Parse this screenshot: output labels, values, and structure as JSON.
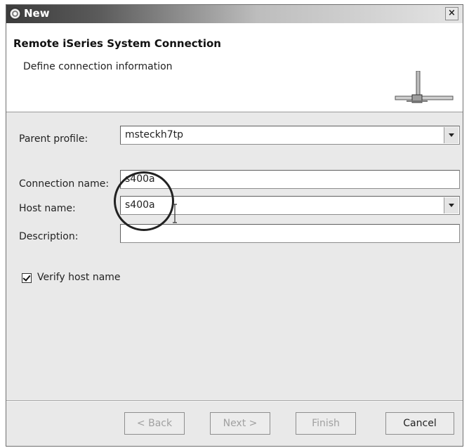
{
  "window": {
    "title": "New",
    "close_glyph": "×"
  },
  "banner": {
    "title": "Remote iSeries System Connection",
    "subtitle": "Define connection information"
  },
  "form": {
    "parent_profile": {
      "label": "Parent profile:",
      "value": "msteckh7tp"
    },
    "connection_name": {
      "label": "Connection name:",
      "value": "s400a"
    },
    "host_name": {
      "label": "Host name:",
      "value": "s400a"
    },
    "description": {
      "label": "Description:",
      "value": ""
    },
    "verify_host": {
      "label": "Verify host name",
      "checked": true
    }
  },
  "buttons": {
    "back": "< Back",
    "next": "Next >",
    "finish": "Finish",
    "cancel": "Cancel"
  },
  "icons": {
    "title": "eclipse-icon",
    "banner": "connection-wizard-icon",
    "cursor": "text-cursor-icon"
  }
}
